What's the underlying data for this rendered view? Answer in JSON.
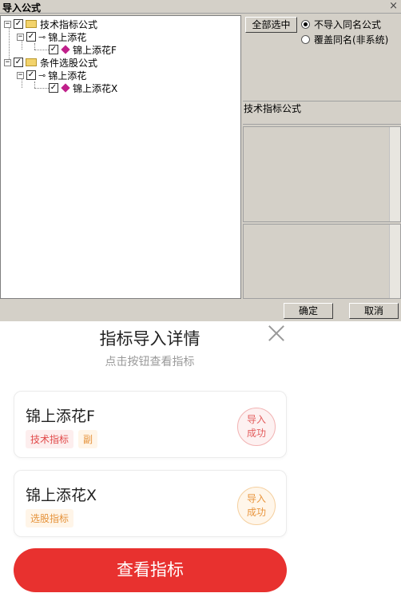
{
  "dialog": {
    "title": "导入公式",
    "close_glyph": "×",
    "tree": [
      {
        "label": "技术指标公式",
        "expander": "−",
        "checked": "✓"
      },
      {
        "label": "锦上添花",
        "expander": "−",
        "checked": "✓"
      },
      {
        "label": "锦上添花F",
        "checked": "✓"
      },
      {
        "label": "条件选股公式",
        "expander": "−",
        "checked": "✓"
      },
      {
        "label": "锦上添花",
        "expander": "−",
        "checked": "✓"
      },
      {
        "label": "锦上添花X",
        "checked": "✓"
      }
    ],
    "select_all_label": "全部选中",
    "radio_options": [
      {
        "label": "不导入同名公式",
        "selected": true
      },
      {
        "label": "覆盖同名(非系统)",
        "selected": false
      }
    ],
    "info_label": "技术指标公式",
    "ok_label": "确定",
    "cancel_label": "取消"
  },
  "modal": {
    "title": "指标导入详情",
    "subtitle": "点击按钮查看指标",
    "cards": [
      {
        "name": "锦上添花F",
        "tags": [
          "技术指标",
          "副"
        ],
        "status": [
          "导入",
          "成功"
        ],
        "status_color": "#e35d5d"
      },
      {
        "name": "锦上添花X",
        "tags": [
          "选股指标"
        ],
        "status": [
          "导入",
          "成功"
        ],
        "status_color": "#e9963f"
      }
    ],
    "primary_label": "查看指标",
    "primary_color": "#e8312f"
  }
}
